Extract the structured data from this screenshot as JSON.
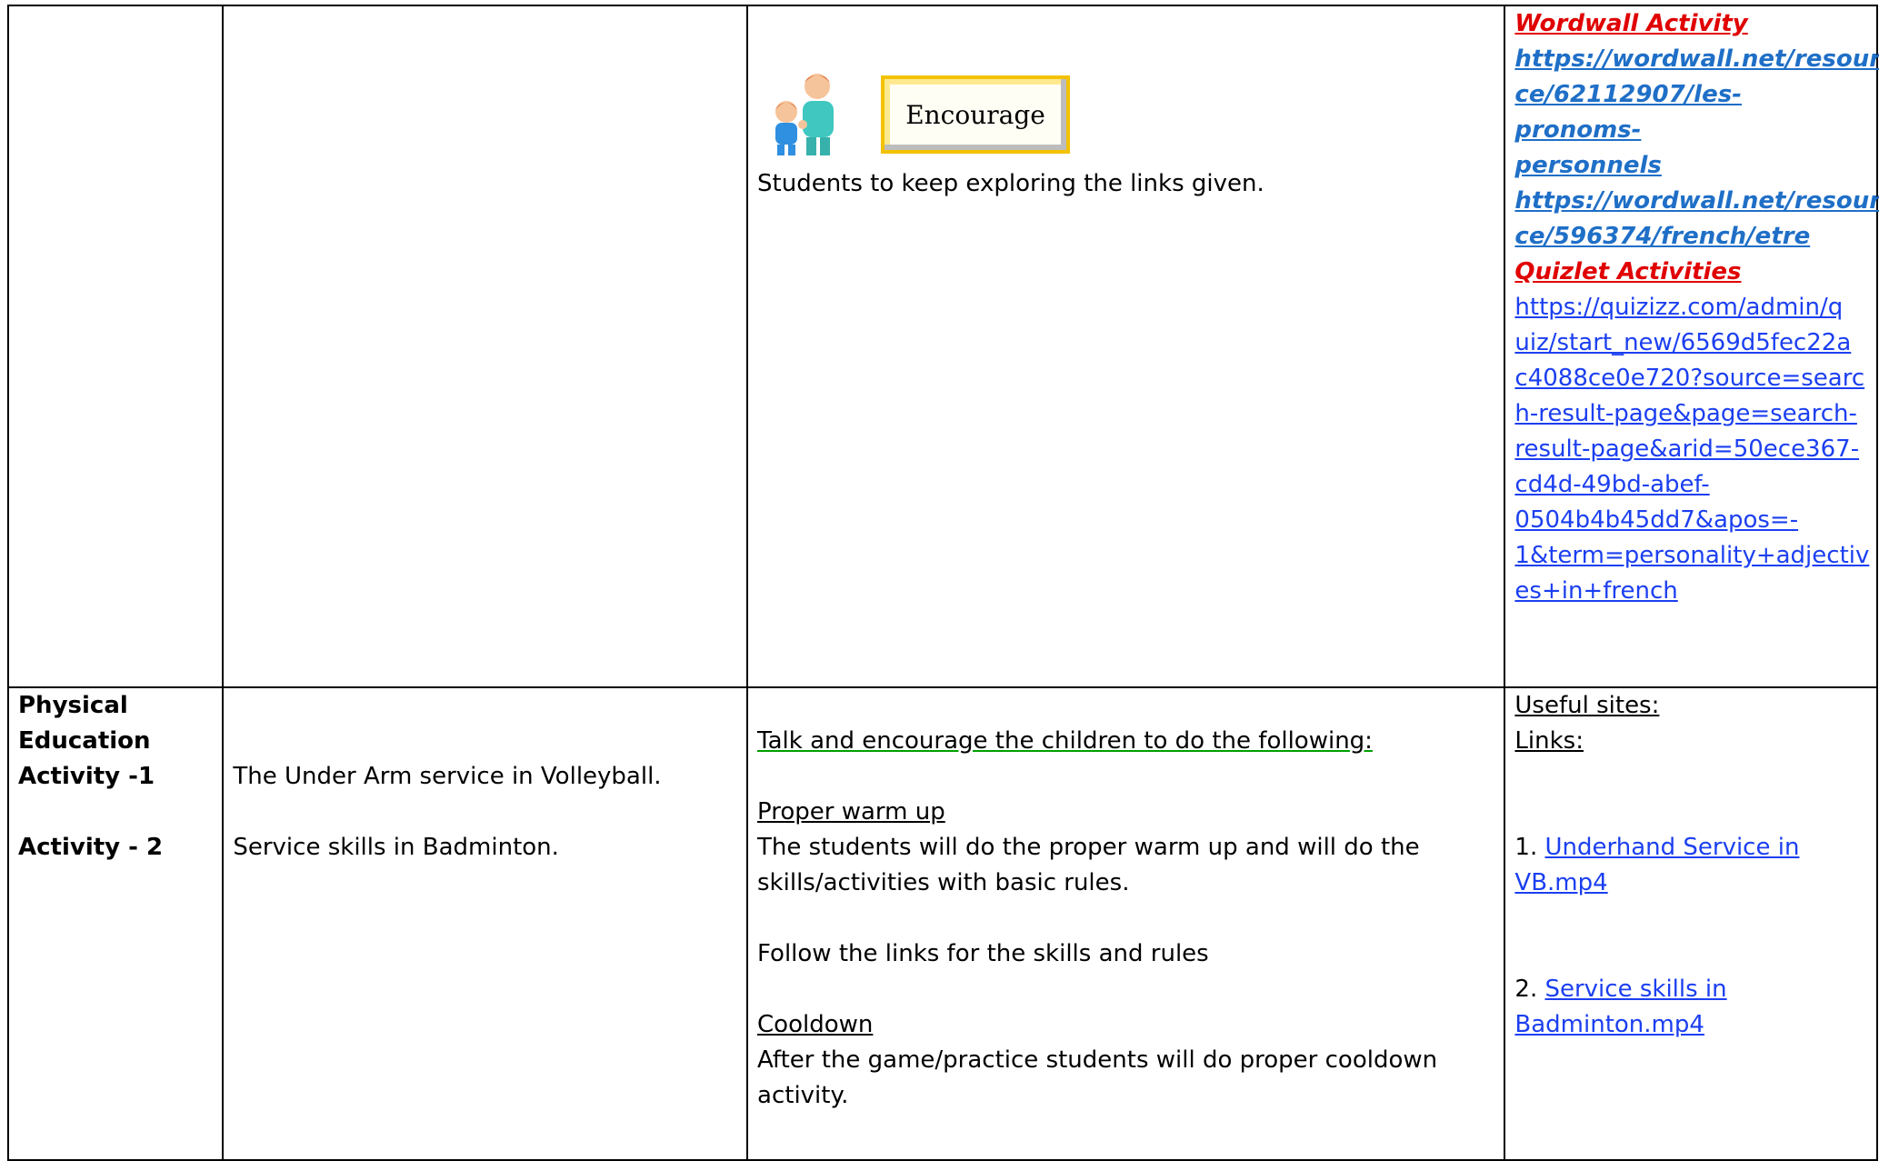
{
  "row1": {
    "encourage_label": "Encourage",
    "encourage_text": "Students to keep exploring the links given.",
    "resources": {
      "wordwall_heading": "Wordwall Activity",
      "wordwall_link1_a": "https://wordwall.net/resour",
      "wordwall_link1_b": "ce/62112907/les-pronoms-",
      "wordwall_link1_c": "personnels",
      "wordwall_link2_a": "https://wordwall.net/resour",
      "wordwall_link2_b": "ce/596374/french/etre",
      "quizlet_heading": "Quizlet Activities",
      "quiz_lines": [
        "https://quizizz.com/admin/q",
        "uiz/start_new/6569d5fec22a",
        "c4088ce0e720?source=searc",
        "h-result-page&page=search-",
        "result-page&arid=50ece367-",
        "cd4d-49bd-abef-",
        "0504b4b45dd7&apos=-",
        "1&term=personality+adjectiv",
        "es+in+french"
      ]
    }
  },
  "row2": {
    "subject_line1": "Physical",
    "subject_line2": "Education",
    "activity1": "Activity -1",
    "activity2": "Activity - 2",
    "topic1": "The Under Arm service in Volleyball.",
    "topic2": "Service skills in Badminton.",
    "intro": "Talk and encourage the children to do the following:",
    "warmup_heading": "Proper warm up",
    "warmup_text": "The students will do the proper warm up and will do the skills/activities with basic rules.",
    "follow_text": "Follow the links for the skills and rules",
    "cooldown_heading": "Cooldown",
    "cooldown_text": "After the game/practice students will do proper cooldown activity.",
    "useful_sites": "Useful sites:",
    "links_label": "Links:",
    "link1_num": "1. ",
    "link1_text": "Underhand Service in VB.mp4",
    "link2_num": "2. ",
    "link2_text": "Service skills in Badminton.mp4"
  },
  "colors": {
    "link": "#1b3ff0",
    "heading_red": "#e00000",
    "heading_blue": "#1f6fc7",
    "box_border": "#f2c200"
  }
}
